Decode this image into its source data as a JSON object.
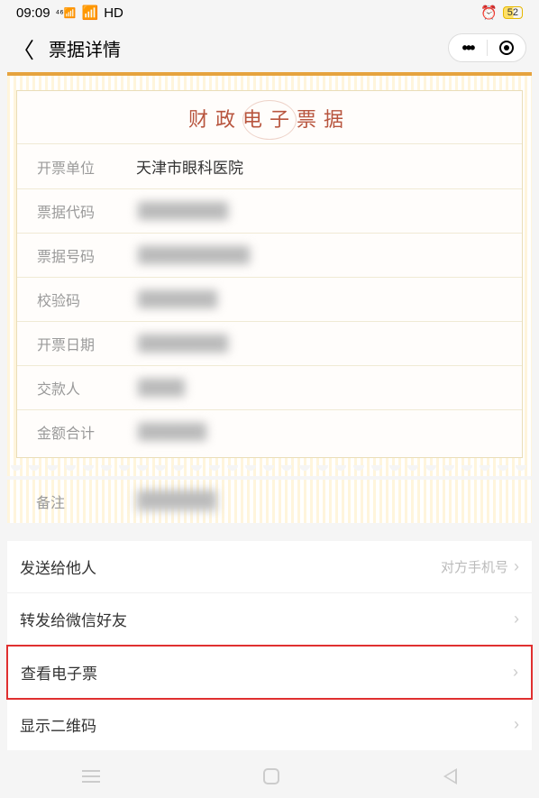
{
  "status": {
    "time": "09:09",
    "signal": "䒑",
    "net": "⁴⁶",
    "wifi": "ᯤ",
    "hd": "HD",
    "alarm": "⏰",
    "battery": "52"
  },
  "nav": {
    "title": "票据详情"
  },
  "ticket": {
    "title": "财政电子票据",
    "rows": {
      "issuer_label": "开票单位",
      "issuer_value": "天津市眼科医院",
      "code_label": "票据代码",
      "code_value": "████████",
      "number_label": "票据号码",
      "number_value": "██████████",
      "check_label": "校验码",
      "check_value": "███████",
      "date_label": "开票日期",
      "date_value": "████████",
      "payer_label": "交款人",
      "payer_value": "████",
      "total_label": "金额合计",
      "total_value": "██████"
    },
    "remark_label": "备注",
    "remark_value": "███████"
  },
  "actions": {
    "send_other": "发送给他人",
    "send_other_hint": "对方手机号",
    "forward_wechat": "转发给微信好友",
    "view_eticket": "查看电子票",
    "show_qr": "显示二维码"
  }
}
